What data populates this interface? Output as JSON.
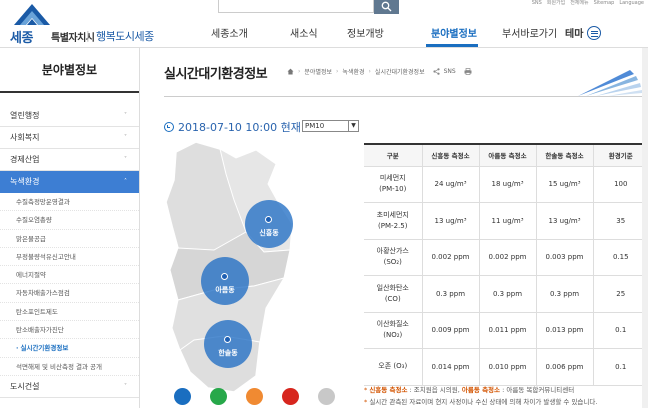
{
  "utility_links": [
    "SNS",
    "회원가입",
    "전체메뉴",
    "Sitemap",
    "Language"
  ],
  "logo": {
    "main": "세종",
    "sub": "특별자치시",
    "slogan": "행복도시세종"
  },
  "gnb": [
    "세종소개",
    "새소식",
    "정보개방",
    "분야별정보",
    "부서바로가기",
    "테마"
  ],
  "sidebar": {
    "title": "분야별정보",
    "items": [
      {
        "label": "열린행정",
        "chevron": "˅"
      },
      {
        "label": "사회복지",
        "chevron": "˅"
      },
      {
        "label": "경제산업",
        "chevron": "˅"
      },
      {
        "label": "녹색환경",
        "chevron": "˄"
      }
    ],
    "subitems": [
      "수질측정망운영결과",
      "수질오염총량",
      "맑은물공급",
      "부정불량석유신고안내",
      "에너지절약",
      "자동차배출가스점검",
      "탄소포인트제도",
      "탄소배출자가진단",
      "실시간기환경정보",
      "석면해제 및 비산측정 결과 공개"
    ],
    "bottom_item": {
      "label": "도시건설",
      "chevron": "˅"
    }
  },
  "content": {
    "title": "실시간대기환경정보",
    "breadcrumb": [
      "분야별정보",
      "녹색환경",
      "실시간대기환경정보"
    ],
    "sns": "SNS",
    "date_text": "2018-07-10 10:00 현재",
    "pm_select": "PM10"
  },
  "map": {
    "stations": [
      {
        "name": "신흥동"
      },
      {
        "name": "아름동"
      },
      {
        "name": "한솔동"
      }
    ],
    "legend_colors": [
      "#1a6ec0",
      "#27a84a",
      "#f08a32",
      "#d7261e",
      "#c8c8c8"
    ]
  },
  "table": {
    "headers": [
      "구분",
      "신흥동 측정소",
      "아름동 측정소",
      "한솔동 측정소",
      "환경기준"
    ],
    "rows": [
      {
        "item": [
          "미세먼지",
          "(PM-10)"
        ],
        "v1": "24 ug/m³",
        "v2": "18 ug/m³",
        "v3": "15 ug/m³",
        "std": "100"
      },
      {
        "item": [
          "초미세먼지",
          "(PM-2.5)"
        ],
        "v1": "13 ug/m³",
        "v2": "11 ug/m³",
        "v3": "13 ug/m³",
        "std": "35"
      },
      {
        "item": [
          "아황산가스",
          "(SO₂)"
        ],
        "v1": "0.002 ppm",
        "v2": "0.002 ppm",
        "v3": "0.003 ppm",
        "std": "0.15"
      },
      {
        "item": [
          "일산화탄소",
          "(CO)"
        ],
        "v1": "0.3 ppm",
        "v2": "0.3 ppm",
        "v3": "0.3 ppm",
        "std": "25"
      },
      {
        "item": [
          "이산화질소",
          "(NO₂)"
        ],
        "v1": "0.009 ppm",
        "v2": "0.011 ppm",
        "v3": "0.013 ppm",
        "std": "0.1"
      },
      {
        "item": [
          "오존 (O₃)"
        ],
        "v1": "0.014 ppm",
        "v2": "0.010 ppm",
        "v3": "0.006 ppm",
        "std": "0.1"
      }
    ]
  },
  "notes": {
    "n1_a": "신흥동 측정소",
    "n1_b": " : 조치원읍 시의원, ",
    "n1_c": "아름동 측정소",
    "n1_d": " : 아름동 복합커뮤니티센터",
    "n2": "실시간 관측된 자료이며 현지 사정이나 수신 상태에 의해 차이가 발생할 수 있습니다."
  }
}
